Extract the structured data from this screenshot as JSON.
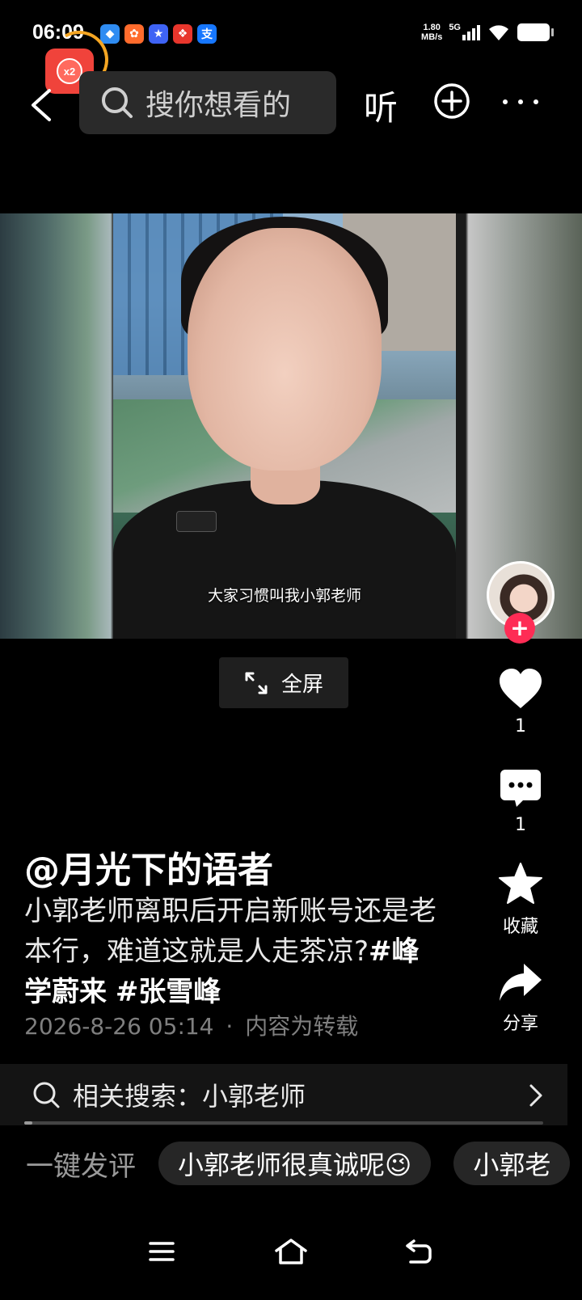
{
  "status_bar": {
    "time": "06:09",
    "network_speed_value": "1.80",
    "network_speed_unit": "MB/s",
    "signal": "5G",
    "app_icons": [
      "blue-app-icon",
      "orange-app-icon",
      "blue-star-app-icon",
      "red-gift-app-icon",
      "alipay-icon"
    ],
    "alipay_label": "支"
  },
  "red_packet": {
    "multiplier": "x2"
  },
  "top_nav": {
    "search_placeholder": "搜你想看的",
    "listen_label": "听"
  },
  "video": {
    "subtitle": "大家习惯叫我小郭老师",
    "fullscreen_label": "全屏"
  },
  "actions": {
    "like_count": "1",
    "comment_count": "1",
    "favorite_label": "收藏",
    "share_label": "分享"
  },
  "post": {
    "author": "@月光下的语者",
    "description": "小郭老师离职后开启新账号还是老本行，难道这就是人走茶凉?",
    "hashtags": [
      "#峰学蔚来",
      "#张雪峰"
    ],
    "date": "2026-8-26 05:14",
    "source_note": "内容为转载",
    "separator": "·"
  },
  "related_search": {
    "label": "相关搜索：小郭老师"
  },
  "quick_comment": {
    "label": "一键发评",
    "chips": [
      "小郭老师很真诚呢😉",
      "小郭老"
    ]
  },
  "colors": {
    "accent_red": "#fe2c55",
    "background": "#000000"
  }
}
